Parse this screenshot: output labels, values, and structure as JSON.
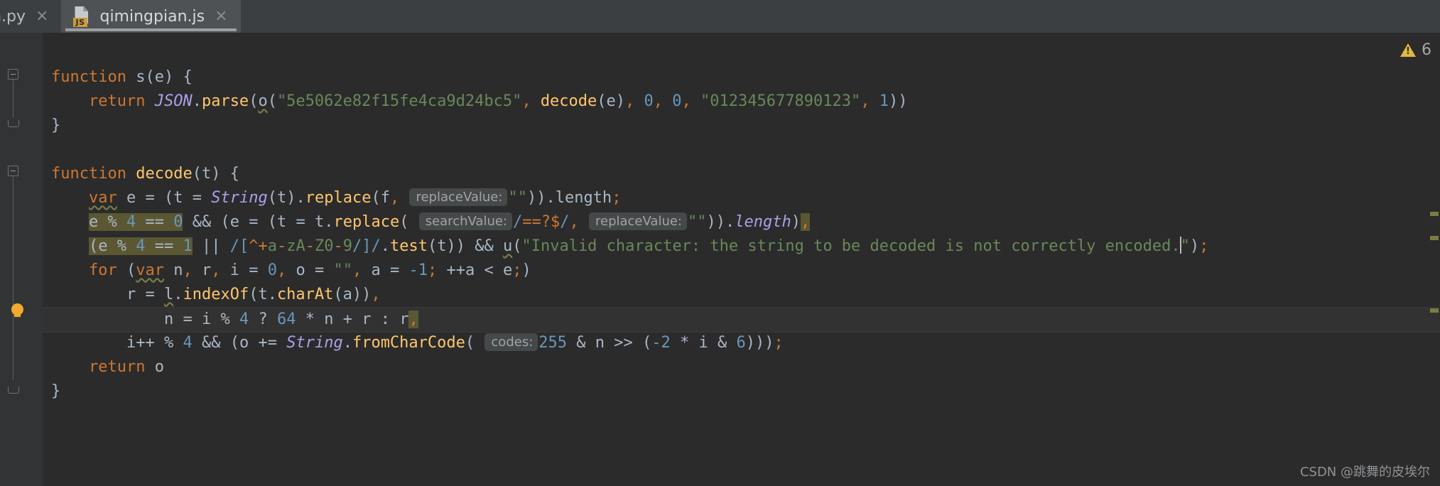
{
  "tabs": [
    {
      "label": "in.py",
      "icon": "python-file-icon",
      "close": "×",
      "active": false
    },
    {
      "label": "qimingpian.js",
      "icon": "js-file-icon",
      "badge": "JS",
      "close": "×",
      "active": true
    }
  ],
  "inspection": {
    "warning_count": "6",
    "icon": "warning-triangle-icon"
  },
  "gutter": {
    "bulb_icon": "intention-bulb-icon",
    "fold_collapse_icon": "fold-collapse-icon",
    "fold_end_icon": "fold-end-icon"
  },
  "watermark": "CSDN @跳舞的皮埃尔",
  "code": {
    "lines": [
      "function s(e) {",
      "    return JSON.parse(o(\"5e5062e82f15fe4ca9d24bc5\", decode(e), 0, 0, \"012345677890123\", 1))",
      "}",
      "",
      "function decode(t) {",
      "    var e = (t = String(t).replace(f, replaceValue: \"\")).length;",
      "    e % 4 == 0 && (e = (t = t.replace( searchValue: /==?$/, replaceValue: \"\")).length),",
      "    (e % 4 == 1 || /[^+a-zA-Z0-9/]/.test(t)) && u(\"Invalid character: the string to be decoded is not correctly encoded.\");",
      "    for (var n, r, i = 0, o = \"\", a = -1; ++a < e;)",
      "        r = l.indexOf(t.charAt(a)),",
      "            n = i % 4 ? 64 * n + r : r,",
      "        i++ % 4 && (o += String.fromCharCode( codes: 255 & n >> (-2 * i & 6)));",
      "    return o",
      "}"
    ],
    "strings": {
      "hash": "5e5062e82f15fe4ca9d24bc5",
      "digits": "012345677890123",
      "empty": "\"\"",
      "regex_search": "/==?$/",
      "regex_test": "/[^+a-zA-Z0-9/]/",
      "error_message": "Invalid character: the string to be decoded is not correctly encoded."
    },
    "hints": {
      "replace_value": "replaceValue:",
      "search_value": "searchValue:",
      "codes": "codes:"
    },
    "selection_text_1": "e % 4 == 0",
    "selection_text_2": "(e % 4 == 1"
  }
}
